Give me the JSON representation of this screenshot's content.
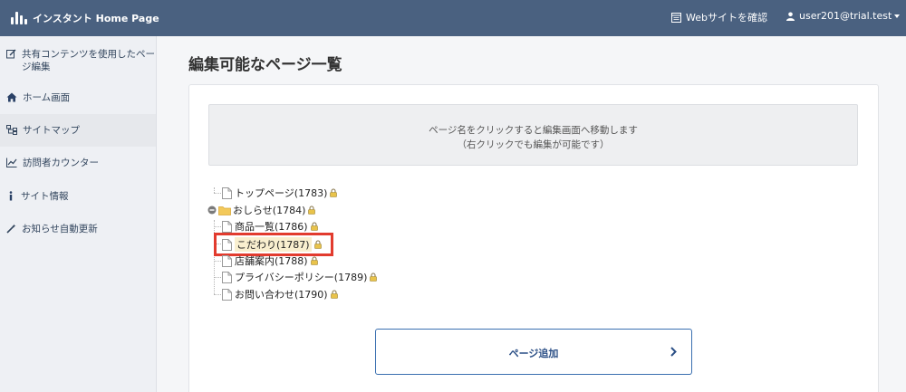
{
  "app": {
    "title": "インスタント Home Page"
  },
  "header": {
    "view_site_label": "Webサイトを確認",
    "user_email": "user201@trial.test"
  },
  "sidebar": {
    "items": [
      {
        "label": "共有コンテンツを使用したページ編集",
        "icon": "edit-icon"
      },
      {
        "label": "ホーム画面",
        "icon": "home-icon"
      },
      {
        "label": "サイトマップ",
        "icon": "sitemap-icon"
      },
      {
        "label": "訪問者カウンター",
        "icon": "chart-icon"
      },
      {
        "label": "サイト情報",
        "icon": "info-icon"
      },
      {
        "label": "お知らせ自動更新",
        "icon": "magic-wand-icon"
      }
    ]
  },
  "main": {
    "title": "編集可能なページ一覧",
    "notice_line1": "ページ名をクリックすると編集画面へ移動します",
    "notice_line2": "（右クリックでも編集が可能です）",
    "tree": [
      {
        "label": "トップページ(1783)",
        "type": "page"
      },
      {
        "label": "おしらせ(1784)",
        "type": "folder"
      },
      {
        "label": "商品一覧(1786)",
        "type": "page"
      },
      {
        "label": "こだわり(1787)",
        "type": "page",
        "highlighted": true
      },
      {
        "label": "店舗案内(1788)",
        "type": "page"
      },
      {
        "label": "プライバシーポリシー(1789)",
        "type": "page"
      },
      {
        "label": "お問い合わせ(1790)",
        "type": "page"
      }
    ],
    "add_button_label": "ページ追加"
  },
  "colors": {
    "header_bg": "#4a6180",
    "sidebar_bg": "#eef0f4",
    "highlight_border": "#e23b2e",
    "button_border": "#3a6fb0"
  }
}
